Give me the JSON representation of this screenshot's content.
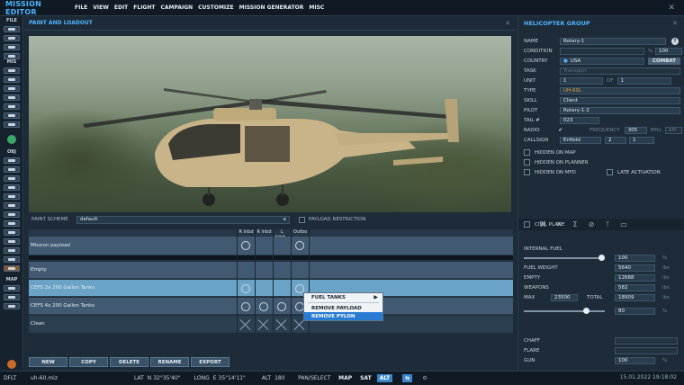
{
  "app_title": "MISSION EDITOR",
  "menu": [
    "FILE",
    "VIEW",
    "EDIT",
    "FLIGHT",
    "CAMPAIGN",
    "CUSTOMIZE",
    "MISSION GENERATOR",
    "MISC"
  ],
  "left_toolbar": {
    "sections": [
      "FILE",
      "MIS",
      "OBJ",
      "MAP"
    ]
  },
  "paint_panel": {
    "title": "PAINT AND LOADOUT",
    "paint_scheme_label": "PAINT SCHEME",
    "paint_scheme_value": "default",
    "payload_restriction_label": "PAYLOAD RESTRICTION",
    "columns": [
      "R Inbd",
      "R Inbd",
      "L Inbd...",
      "Outbo"
    ],
    "rows": [
      {
        "label": "Mission payload"
      },
      {
        "label": "Empty"
      },
      {
        "label": "CEFS 2x 200 Gallon Tanks"
      },
      {
        "label": "CEFS 4x 200 Gallon Tanks"
      },
      {
        "label": "Clean"
      }
    ],
    "context_menu": [
      "FUEL TANKS",
      "REMOVE PAYLOAD",
      "REMOVE PYLON"
    ],
    "buttons": [
      "NEW",
      "COPY",
      "DELETE",
      "RENAME",
      "EXPORT"
    ]
  },
  "heli_group": {
    "title": "HELICOPTER GROUP",
    "name_label": "NAME",
    "name_value": "Rotary-1",
    "condition_label": "CONDITION",
    "condition_unit": "%",
    "condition_value": "100",
    "country_label": "COUNTRY",
    "country_value": "USA",
    "combat_label": "COMBAT",
    "task_label": "TASK",
    "task_value": "Transport",
    "unit_label": "UNIT",
    "unit_value": "1",
    "unit_of": "OF",
    "unit_total": "1",
    "type_label": "TYPE",
    "type_value": "UH-60L",
    "skill_label": "SKILL",
    "skill_value": "Client",
    "pilot_label": "PILOT",
    "pilot_value": "Rotary-1-2",
    "tail_label": "TAIL #",
    "tail_value": "023",
    "radio_label": "RADIO",
    "freq_label": "FREQUENCY",
    "freq_value": "305",
    "freq_unit": "MHz",
    "am_label": "AM",
    "callsign_label": "CALLSIGN",
    "callsign_value": "Enfield",
    "callsign_n1": "2",
    "callsign_n2": "1",
    "hidden_map": "HIDDEN ON MAP",
    "hidden_planner": "HIDDEN ON PLANNER",
    "hidden_mfd": "HIDDEN ON MFD",
    "late_activation": "LATE ACTIVATION"
  },
  "fuel_panel": {
    "civil_plane": "CIVIL PLANE",
    "internal_fuel": "INTERNAL FUEL",
    "internal_fuel_value": "100",
    "internal_fuel_fraction": 1.0,
    "fuel_weight_label": "FUEL WEIGHT",
    "fuel_weight_value": "5640",
    "empty_label": "EMPTY",
    "empty_value": "12688",
    "weapons_label": "WEAPONS",
    "weapons_value": "582",
    "max_label": "MAX",
    "max_value": "23500",
    "total_label": "TOTAL",
    "total_value": "18909",
    "weight_unit": "lbs",
    "pct_unit": "%",
    "cargo_value": "80",
    "cargo_fraction": 0.8,
    "chaff_label": "CHAFF",
    "flare_label": "FLARE",
    "gun_label": "GUN",
    "gun_value": "100"
  },
  "status_bar": {
    "layer": "DFLT",
    "file": "uh-60.miz",
    "lat_label": "LAT",
    "lat_value": "N 32°35'40\"",
    "long_label": "LONG",
    "long_value": "E 35°14'11\"",
    "alt_label": "ALT",
    "alt_value": "180",
    "pan_select": "PAN/SELECT",
    "map": "MAP",
    "sat": "SAT",
    "alt": "ALT",
    "datetime": "15.01.2022 19:18:02"
  }
}
